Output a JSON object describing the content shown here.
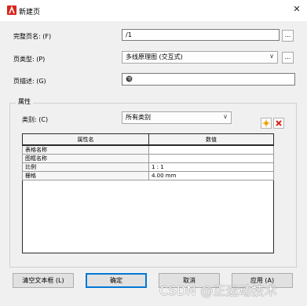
{
  "window": {
    "title": "新建页",
    "close_glyph": "✕"
  },
  "fields": {
    "full_name_label": "完整页名: (F)",
    "full_name_value": "/1",
    "page_type_label": "页类型: (P)",
    "page_type_value": "多线原理图 (交互式)",
    "page_desc_label": "页描述: (G)",
    "ellipsis": "..."
  },
  "properties": {
    "group_title": "属性",
    "category_label": "类别: (C)",
    "category_value": "所有类别",
    "columns": [
      "属性名",
      "数值"
    ],
    "rows": [
      {
        "name": "表格名称",
        "value": ""
      },
      {
        "name": "图框名称",
        "value": ""
      },
      {
        "name": "比例",
        "value": "1 : 1"
      },
      {
        "name": "栅格",
        "value": "4.00 mm"
      }
    ]
  },
  "buttons": {
    "clear_textbox": "清空文本框 (L)",
    "ok": "确定",
    "cancel": "取消",
    "apply": "应用 (A)"
  },
  "watermark": "CSDN @正运动技术",
  "colors": {
    "accent": "#0078d7",
    "delete_red": "#d9261c",
    "new_star": "#f0a000"
  }
}
